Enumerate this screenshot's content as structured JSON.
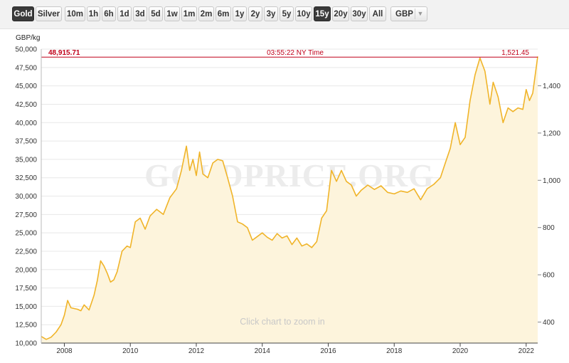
{
  "toolbar": {
    "metals": [
      {
        "label": "Gold",
        "active": true
      },
      {
        "label": "Silver",
        "active": false
      }
    ],
    "ranges": [
      {
        "label": "10m",
        "active": false
      },
      {
        "label": "1h",
        "active": false
      },
      {
        "label": "6h",
        "active": false
      },
      {
        "label": "1d",
        "active": false
      },
      {
        "label": "3d",
        "active": false
      },
      {
        "label": "5d",
        "active": false
      },
      {
        "label": "1w",
        "active": false
      },
      {
        "label": "1m",
        "active": false
      },
      {
        "label": "2m",
        "active": false
      },
      {
        "label": "6m",
        "active": false
      },
      {
        "label": "1y",
        "active": false
      },
      {
        "label": "2y",
        "active": false
      },
      {
        "label": "3y",
        "active": false
      },
      {
        "label": "5y",
        "active": false
      },
      {
        "label": "10y",
        "active": false
      },
      {
        "label": "15y",
        "active": true
      },
      {
        "label": "20y",
        "active": false
      },
      {
        "label": "30y",
        "active": false
      },
      {
        "label": "All",
        "active": false
      }
    ],
    "currency": "GBP"
  },
  "chart_data": {
    "type": "area",
    "ylabel": "GBP/kg",
    "watermark": "GOLDPRICE.ORG",
    "hint": "Click chart to zoom in",
    "current_left_value": "48,915.71",
    "current_time": "03:55:22 NY Time",
    "current_right_value": "1,521.45",
    "current_level": 48915.71,
    "ylim": [
      10000,
      50000
    ],
    "yticks": [
      "10,000",
      "12,500",
      "15,000",
      "17,500",
      "20,000",
      "22,500",
      "25,000",
      "27,500",
      "30,000",
      "32,500",
      "35,000",
      "37,500",
      "40,000",
      "42,500",
      "45,000",
      "47,500",
      "50,000"
    ],
    "ytick_values": [
      10000,
      12500,
      15000,
      17500,
      20000,
      22500,
      25000,
      27500,
      30000,
      32500,
      35000,
      37500,
      40000,
      42500,
      45000,
      47500,
      50000
    ],
    "y2ticks": [
      "400",
      "600",
      "800",
      "1,000",
      "1,200",
      "1,400"
    ],
    "y2tick_values": [
      400,
      600,
      800,
      1000,
      1200,
      1400
    ],
    "y2_per_kg_factor": 32.15,
    "xlim": [
      2007.3,
      2022.35
    ],
    "xticks": [
      "2008",
      "2010",
      "2012",
      "2014",
      "2016",
      "2018",
      "2020",
      "2022"
    ],
    "xtick_values": [
      2008,
      2010,
      2012,
      2014,
      2016,
      2018,
      2020,
      2022
    ],
    "colors": {
      "line": "#f0b429",
      "fill": "#fdf4dc",
      "current": "#c0001a",
      "grid": "#e8e8e8",
      "watermark": "#ececec"
    },
    "series": [
      {
        "x": [
          2007.3,
          2007.45,
          2007.6,
          2007.75,
          2007.9,
          2008.0,
          2008.1,
          2008.2,
          2008.3,
          2008.4,
          2008.5,
          2008.6,
          2008.75,
          2008.9,
          2009.0,
          2009.1,
          2009.2,
          2009.3,
          2009.4,
          2009.5,
          2009.6,
          2009.75,
          2009.9,
          2010.0,
          2010.15,
          2010.3,
          2010.45,
          2010.6,
          2010.8,
          2011.0,
          2011.2,
          2011.4,
          2011.55,
          2011.7,
          2011.8,
          2011.9,
          2012.0,
          2012.1,
          2012.2,
          2012.35,
          2012.5,
          2012.65,
          2012.8,
          2012.95,
          2013.1,
          2013.25,
          2013.4,
          2013.55,
          2013.7,
          2013.85,
          2014.0,
          2014.15,
          2014.3,
          2014.45,
          2014.6,
          2014.75,
          2014.9,
          2015.05,
          2015.2,
          2015.35,
          2015.5,
          2015.65,
          2015.8,
          2015.95,
          2016.1,
          2016.25,
          2016.4,
          2016.55,
          2016.7,
          2016.85,
          2017.0,
          2017.2,
          2017.4,
          2017.6,
          2017.8,
          2018.0,
          2018.2,
          2018.4,
          2018.6,
          2018.8,
          2019.0,
          2019.2,
          2019.4,
          2019.55,
          2019.7,
          2019.85,
          2020.0,
          2020.15,
          2020.3,
          2020.45,
          2020.6,
          2020.75,
          2020.9,
          2021.0,
          2021.15,
          2021.3,
          2021.45,
          2021.6,
          2021.75,
          2021.9,
          2022.0,
          2022.1,
          2022.2,
          2022.35
        ],
        "y": [
          10900,
          10500,
          10800,
          11500,
          12500,
          13800,
          15800,
          14800,
          14700,
          14600,
          14400,
          15200,
          14500,
          16500,
          18500,
          21200,
          20500,
          19500,
          18300,
          18600,
          19700,
          22500,
          23200,
          23000,
          26500,
          27000,
          25500,
          27300,
          28200,
          27500,
          29800,
          31000,
          33500,
          36800,
          33500,
          35000,
          32800,
          36000,
          33000,
          32500,
          34500,
          35000,
          34800,
          32500,
          30000,
          26500,
          26200,
          25700,
          24000,
          24500,
          25000,
          24400,
          24000,
          24900,
          24300,
          24600,
          23400,
          24300,
          23200,
          23500,
          23000,
          23800,
          27000,
          28000,
          33500,
          32000,
          33500,
          32000,
          31500,
          30000,
          30800,
          31500,
          30900,
          31400,
          30500,
          30300,
          30700,
          30500,
          31000,
          29500,
          31000,
          31600,
          32500,
          34500,
          36500,
          40000,
          37000,
          38000,
          43000,
          46500,
          48800,
          47000,
          42500,
          45500,
          43500,
          40000,
          42000,
          41500,
          42000,
          41800,
          44500,
          43000,
          44000,
          49000
        ]
      }
    ]
  }
}
